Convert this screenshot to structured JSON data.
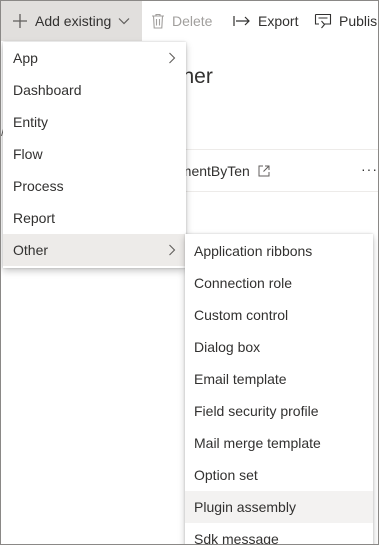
{
  "toolbar": {
    "add_existing_label": "Add existing",
    "delete_label": "Delete",
    "export_label": "Export",
    "publish_label": "Publish"
  },
  "page": {
    "title_fragment": "sher",
    "row_name_fragment": "ementByTen",
    "row_more_label": "···"
  },
  "add_existing_menu": {
    "items": [
      {
        "label": "App",
        "has_submenu": true
      },
      {
        "label": "Dashboard"
      },
      {
        "label": "Entity"
      },
      {
        "label": "Flow"
      },
      {
        "label": "Process"
      },
      {
        "label": "Report"
      },
      {
        "label": "Other",
        "has_submenu": true,
        "active": true
      }
    ]
  },
  "other_submenu": {
    "items": [
      {
        "label": "Application ribbons"
      },
      {
        "label": "Connection role"
      },
      {
        "label": "Custom control"
      },
      {
        "label": "Dialog box"
      },
      {
        "label": "Email template"
      },
      {
        "label": "Field security profile"
      },
      {
        "label": "Mail merge template"
      },
      {
        "label": "Option set"
      },
      {
        "label": "Plugin assembly",
        "hover": true
      },
      {
        "label": "Sdk message"
      }
    ]
  },
  "colors": {
    "accent": "#0078d4",
    "active_bg": "#edebe9",
    "hover_bg": "#f3f2f1",
    "disabled_text": "#a19f9d"
  },
  "icons": {
    "add": "plus-icon",
    "delete": "trash-icon",
    "export": "export-arrow-icon",
    "publish": "publish-icon",
    "chevron_down": "chevron-down-icon",
    "chevron_right": "chevron-right-icon",
    "external": "open-external-icon"
  }
}
